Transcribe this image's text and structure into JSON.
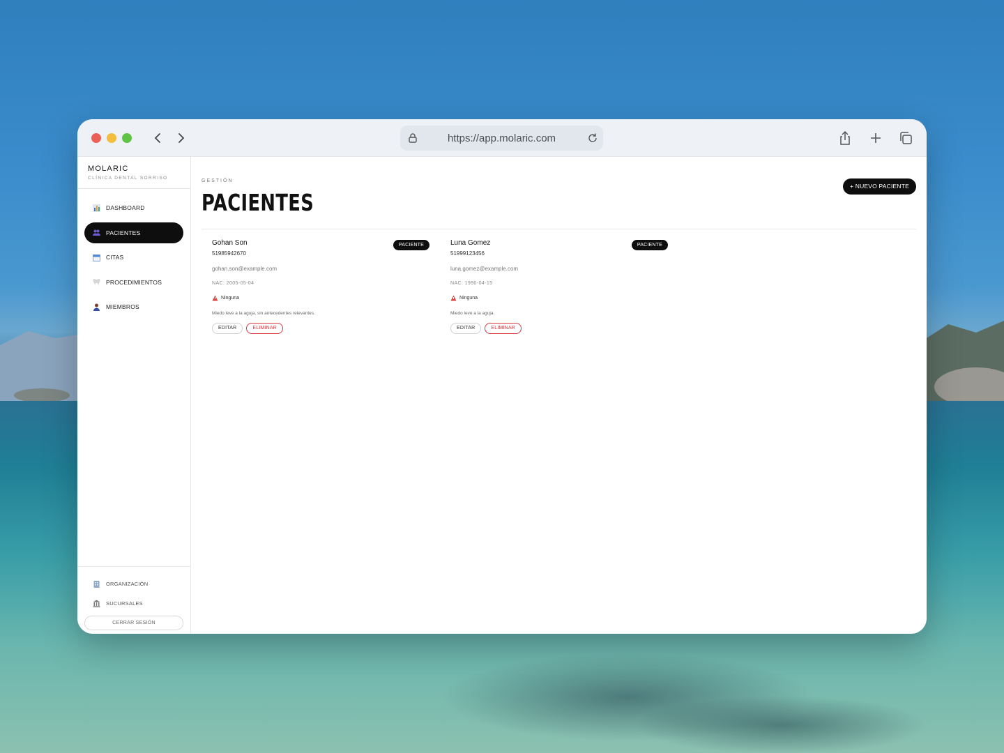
{
  "browser": {
    "url": "https://app.molaric.com"
  },
  "brand": {
    "name": "MOLARIC",
    "subtitle": "CLÍNICA DENTAL SORRISO"
  },
  "sidebar": {
    "items": [
      {
        "label": "DASHBOARD",
        "icon": "chart-icon",
        "active": false
      },
      {
        "label": "PACIENTES",
        "icon": "people-icon",
        "active": true
      },
      {
        "label": "CITAS",
        "icon": "calendar-icon",
        "active": false
      },
      {
        "label": "PROCEDIMIENTOS",
        "icon": "tooth-icon",
        "active": false
      },
      {
        "label": "MIEMBROS",
        "icon": "user-icon",
        "active": false
      }
    ],
    "bottom_items": [
      {
        "label": "ORGANIZACIÓN",
        "icon": "building-icon"
      },
      {
        "label": "SUCURSALES",
        "icon": "bank-icon"
      }
    ],
    "logout_label": "CERRAR SESIÓN"
  },
  "main": {
    "section_label": "GESTIÓN",
    "title": "PACIENTES",
    "new_button": "+ NUEVO PACIENTE"
  },
  "patients": [
    {
      "name": "Gohan Son",
      "badge": "PACIENTE",
      "phone": "51985942670",
      "email": "gohan.son@example.com",
      "birth": "NAC: 2005-05-04",
      "allergy": "Ninguna",
      "note": "Miedo leve a la aguja, sin antecedentes relevantes.",
      "edit_label": "EDITAR",
      "delete_label": "ELIMINAR"
    },
    {
      "name": "Luna Gomez",
      "badge": "PACIENTE",
      "phone": "51999123456",
      "email": "luna.gomez@example.com",
      "birth": "NAC: 1990-04-15",
      "allergy": "Ninguna",
      "note": "Miedo leve a la aguja.",
      "edit_label": "EDITAR",
      "delete_label": "ELIMINAR"
    }
  ],
  "colors": {
    "accent": "#0e0e0e",
    "danger": "#d9363e",
    "chrome": "#eef2f6"
  }
}
